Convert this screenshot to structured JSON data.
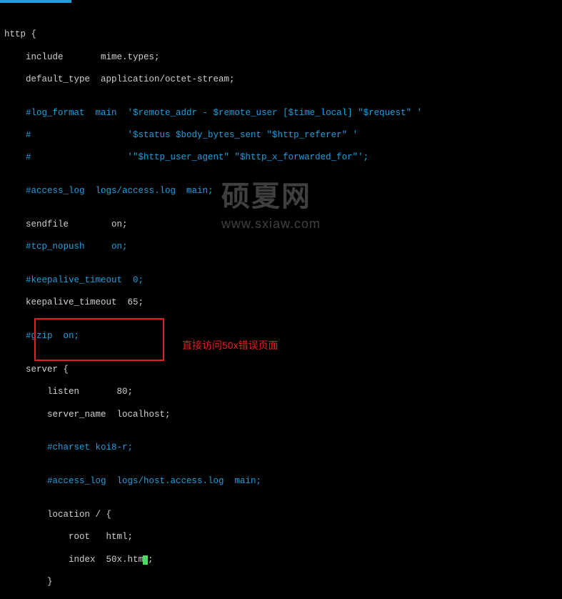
{
  "watermark": {
    "title": "硕夏网",
    "url": "www.sxiaw.com"
  },
  "annotation": "直接访问50x错误页面",
  "code": {
    "l01": "",
    "l02": "http {",
    "l03": "    include       mime.types;",
    "l04": "    default_type  application/octet-stream;",
    "l05": "",
    "l06a": "    #log_format  main  '$remote_addr - $remote_user [$time_local] \"$request\" '",
    "l07a": "    #                  '$status $body_bytes_sent \"$http_referer\" '",
    "l08a": "    #                  '\"$http_user_agent\" \"$http_x_forwarded_for\"';",
    "l09": "",
    "l10a": "    #access_log  logs/access.log  main;",
    "l11": "",
    "l12": "    sendfile        on;",
    "l13a": "    #tcp_nopush     on;",
    "l14": "",
    "l15a": "    #keepalive_timeout  0;",
    "l16": "    keepalive_timeout  65;",
    "l17": "",
    "l18a": "    #gzip  on;",
    "l19": "",
    "l20": "    server {",
    "l21": "        listen       80;",
    "l22": "        server_name  localhost;",
    "l23": "",
    "l24a": "        #charset koi8-r;",
    "l25": "",
    "l26a": "        #access_log  logs/host.access.log  main;",
    "l27": "",
    "l28": "        location / {",
    "l29": "            root   html;",
    "l30": "            index  50x.htm",
    "l30b": ";",
    "l31": "        }"
  }
}
